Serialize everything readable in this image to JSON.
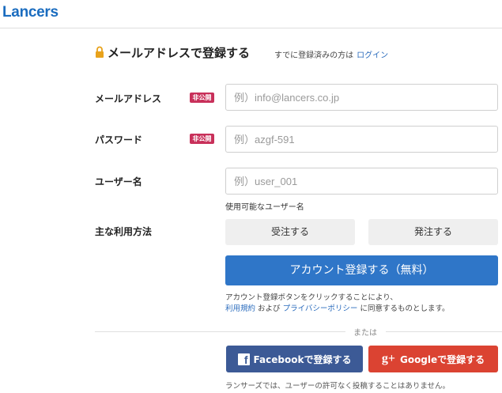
{
  "header": {
    "logo": "Lancers"
  },
  "title": {
    "text": "メールアドレスで登録する",
    "login_prompt": "すでに登録済みの方は",
    "login_link": "ログイン"
  },
  "fields": {
    "email": {
      "label": "メールアドレス",
      "badge": "非公開",
      "placeholder": "例）info@lancers.co.jp"
    },
    "password": {
      "label": "パスワード",
      "badge": "非公開",
      "placeholder": "例）azgf-591"
    },
    "username": {
      "label": "ユーザー名",
      "placeholder": "例）user_001",
      "hint": "使用可能なユーザー名"
    }
  },
  "usage": {
    "label": "主な利用方法",
    "options": [
      "受注する",
      "発注する"
    ]
  },
  "register_button": "アカウント登録する（無料）",
  "terms": {
    "line1": "アカウント登録ボタンをクリックすることにより、",
    "terms_link": "利用規約",
    "and": "および",
    "privacy_link": "プライバシーポリシー",
    "suffix": "に同意するものとします。"
  },
  "divider": "または",
  "social": {
    "facebook_icon": "f",
    "facebook": "Facebookで登録する",
    "google_icon": "g+",
    "google": "Googleで登録する"
  },
  "footer_note": "ランサーズでは、ユーザーの許可なく投稿することはありません。",
  "colors": {
    "brand": "#1a6cbf",
    "primary_button": "#2f76c8",
    "badge": "#c8305a",
    "facebook": "#3c5a96",
    "google": "#db4332",
    "link": "#2b6cbd"
  }
}
